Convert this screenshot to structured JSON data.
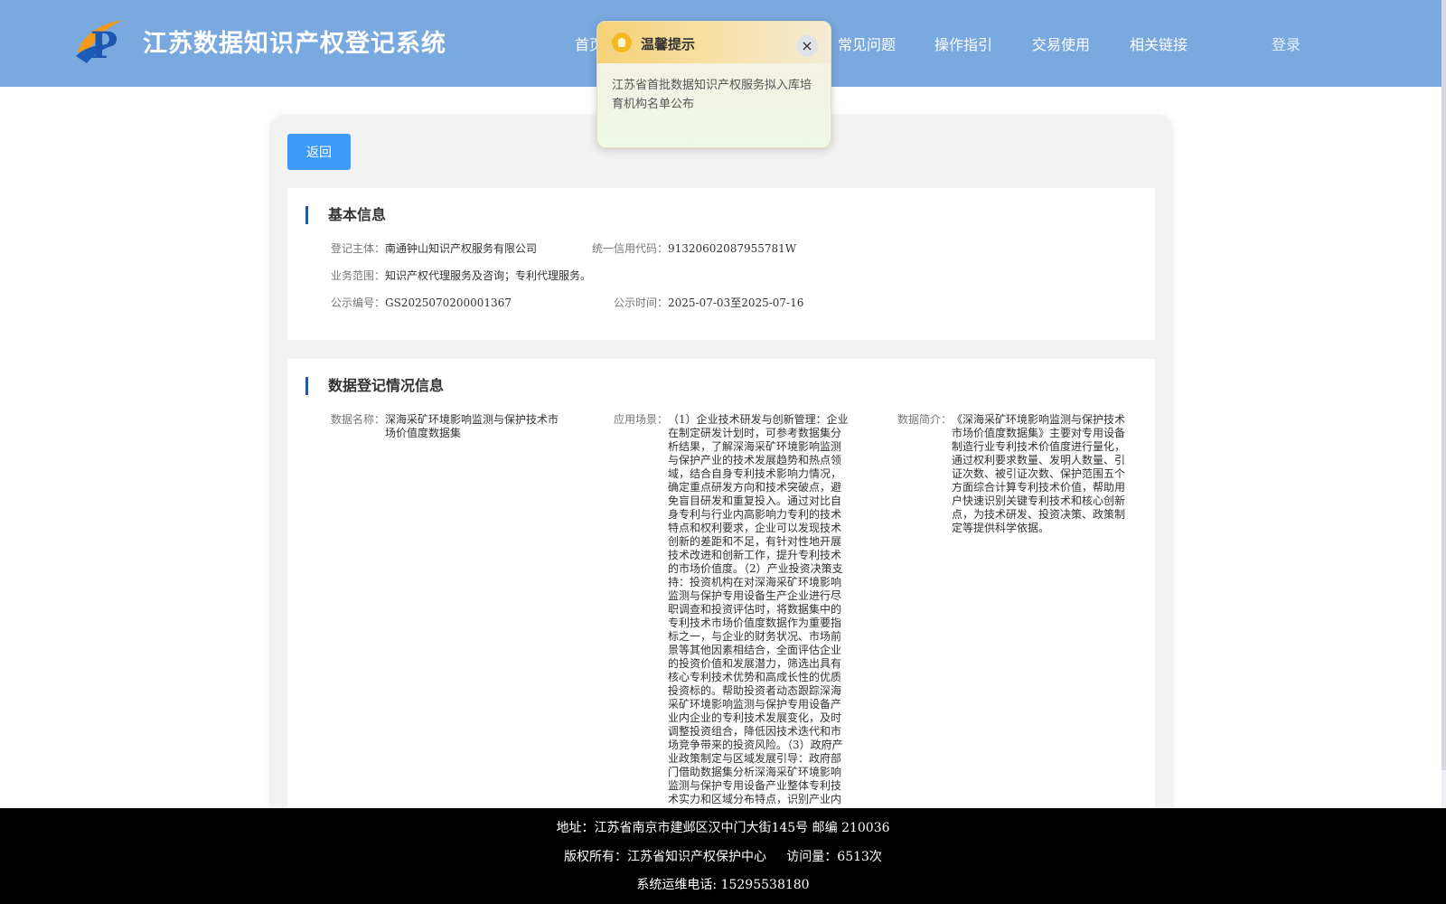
{
  "header": {
    "site_title": "江苏数据知识产权登记系统",
    "nav": [
      "首页",
      "常见问题",
      "操作指引",
      "交易使用",
      "相关链接"
    ],
    "login": "登录"
  },
  "popup": {
    "title": "温馨提示",
    "close": "×",
    "message": "江苏省首批数据知识产权服务拟入库培育机构名单公布"
  },
  "back_button": "返回",
  "basic_info": {
    "title": "基本信息",
    "registrant_label": "登记主体：",
    "registrant_value": "南通钟山知识产权服务有限公司",
    "credit_code_label": "统一信用代码：",
    "credit_code_value": "91320602087955781W",
    "scope_label": "业务范围：",
    "scope_value": "知识产权代理服务及咨询；专利代理服务。",
    "notice_no_label": "公示编号：",
    "notice_no_value": "GS2025070200001367",
    "notice_time_label": "公示时间：",
    "notice_time_value": "2025-07-03至2025-07-16"
  },
  "data_info": {
    "title": "数据登记情况信息",
    "name_label": "数据名称：",
    "name_value": "深海采矿环境影响监测与保护技术市场价值度数据集",
    "scenario_label": "应用场景：",
    "scenario_value": "（1）企业技术研发与创新管理：企业在制定研发计划时，可参考数据集分析结果，了解深海采矿环境影响监测与保护产业的技术发展趋势和热点领域，结合自身专利技术影响力情况，确定重点研发方向和技术突破点，避免盲目研发和重复投入。通过对比自身专利与行业内高影响力专利的技术特点和权利要求，企业可以发现技术创新的差距和不足，有针对性地开展技术改进和创新工作，提升专利技术的市场价值度。（2）产业投资决策支持：投资机构在对深海采矿环境影响监测与保护专用设备生产企业进行尽职调查和投资评估时，将数据集中的专利技术市场价值度数据作为重要指标之一，与企业的财务状况、市场前景等其他因素相结合，全面评估企业的投资价值和发展潜力，筛选出具有核心专利技术优势和高成长性的优质投资标的。帮助投资者动态跟踪深海采矿环境影响监测与保护专用设备产业内企业的专利技术发展变化，及时调整投资组合，降低因技术迭代和市场竞争带来的投资风险。（3）政府产业政策制定与区域发展引导：政府部门借助数据集分析深海采矿环境影响监测与保护专用设备产业整体专利技术实力和区域分布特点，识别产业内",
    "summary_label": "数据简介：",
    "summary_value": "《深海采矿环境影响监测与保护技术市场价值度数据集》主要对专用设备制造行业专利技术价值度进行量化，通过权利要求数量、发明人数量、引证次数、被引证次数、保护范围五个方面综合计算专利技术价值，帮助用户快速识别关键专利技术和核心创新点，为技术研发、投资决策、政策制定等提供科学依据。"
  },
  "footer": {
    "address": "地址：江苏省南京市建邺区汉中门大街145号 邮编 210036",
    "copyright": "版权所有：江苏省知识产权保护中心     访问量：6513次",
    "phone": "系统运维电话: 15295538180"
  }
}
